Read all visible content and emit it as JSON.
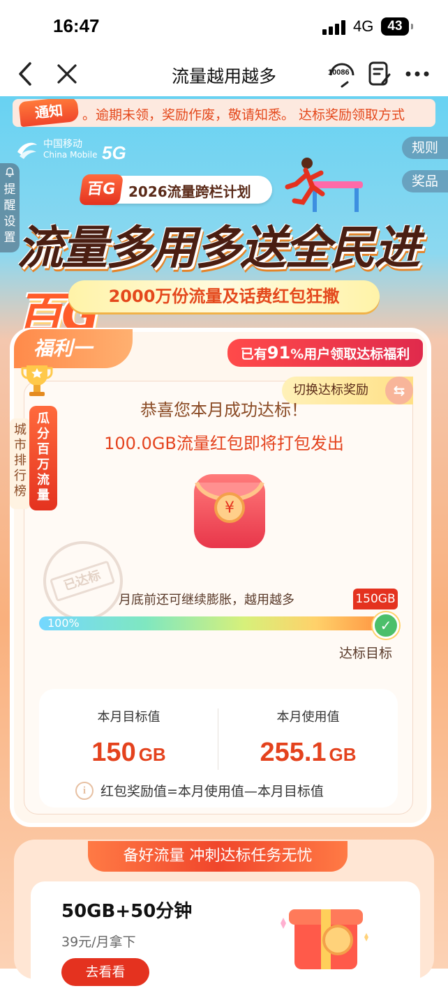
{
  "status": {
    "time": "16:47",
    "network": "4G",
    "battery": "43"
  },
  "nav": {
    "title": "流量越用越多",
    "service_label": "10086"
  },
  "notice": {
    "badge": "通知",
    "text": "。逾期未领，奖励作废，敬请知悉。   达标奖励领取方式"
  },
  "brand": {
    "cn": "中国移动",
    "en": "China Mobile",
    "tag": "5G"
  },
  "side": {
    "rules": "规则",
    "prizes": "奖品",
    "remind": "提醒设置"
  },
  "banner": {
    "plan_badge": "百G",
    "plan_text": "2026流量跨栏计划",
    "hero_part1": "流量多用多送",
    "hero_part2": "全民进",
    "hero_highlight": "百G",
    "sub": "2000万份流量及话费红包狂撒"
  },
  "welfare": {
    "tab": "福利一",
    "users_prefix": "已有",
    "users_pct": "91",
    "users_suffix": "%用户领取达标福利",
    "switch_label": "切换达标奖励",
    "rank_city": "城市排行榜",
    "rank_main": "瓜分百万流量",
    "congrats_line1": "恭喜您本月成功达标！",
    "congrats_line2": "100.0GB流量红包即将打包发出",
    "stamp": "已达标",
    "keep_growing": "月底前还可继续膨胀，越用越多",
    "target_tag": "150GB",
    "progress_label": "100%",
    "progress": 1.0,
    "target_goal": "达标目标",
    "stats": [
      {
        "label": "本月目标值",
        "value": "150",
        "unit": "GB"
      },
      {
        "label": "本月使用值",
        "value": "255.1",
        "unit": "GB"
      }
    ],
    "formula": "红包奖励值=本月使用值—本月目标值"
  },
  "section2": {
    "title": "备好流量 冲刺达标任务无忧",
    "offer_title": "50GB+50分钟",
    "offer_price": "39元/月拿下",
    "offer_button": "去看看"
  },
  "colors": {
    "accent": "#e4321f",
    "orange": "#e4421d",
    "brown": "#8a4a24"
  }
}
